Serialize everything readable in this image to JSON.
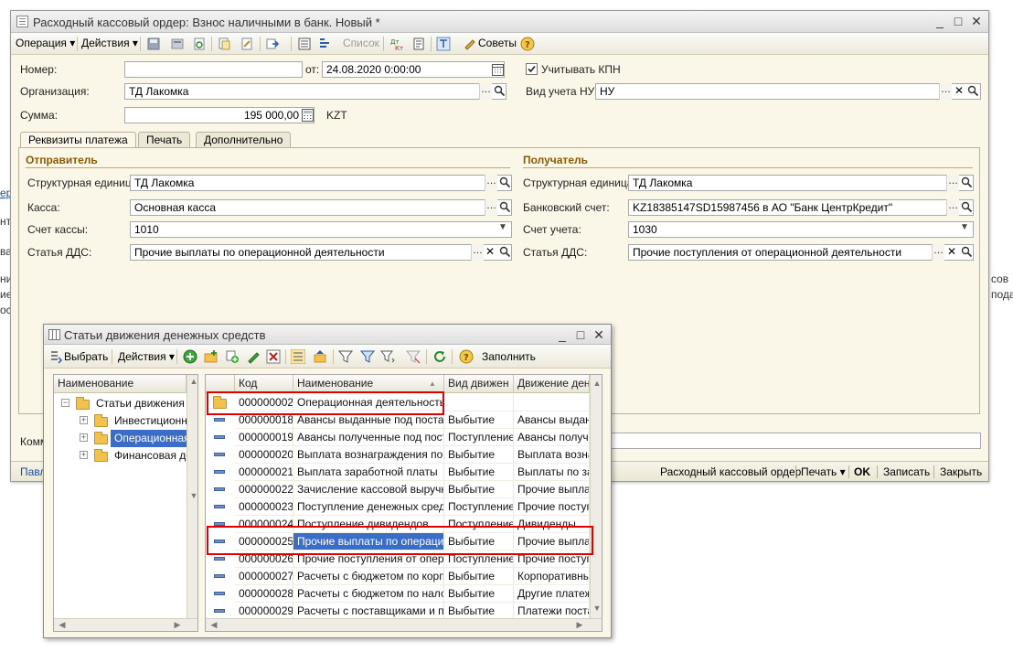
{
  "background": {
    "left_fragments": [
      "ер",
      "нт",
      "ва",
      "ни",
      "ие",
      "ос"
    ],
    "right_fragments": [
      "сов",
      "пода"
    ]
  },
  "main_window": {
    "title": "Расходный кассовый ордер: Взнос наличными в банк. Новый *",
    "controls": [
      "_",
      "□",
      "✕"
    ],
    "toolbar": {
      "operation": "Операция ▾",
      "actions": "Действия ▾",
      "list": "Список",
      "advice": "Советы"
    },
    "fields": {
      "number_label": "Номер:",
      "number_value": "",
      "date_label": "от:",
      "date_value": "24.08.2020  0:00:00",
      "kpn_label": "Учитывать КПН",
      "org_label": "Организация:",
      "org_value": "ТД Лакомка",
      "nu_label": "Вид учета НУ:",
      "nu_value": "НУ",
      "sum_label": "Сумма:",
      "sum_value": "195 000,00",
      "currency": "KZT"
    },
    "tabs": [
      "Реквизиты платежа",
      "Печать",
      "Дополнительно"
    ],
    "sender": {
      "title": "Отправитель",
      "unit_label": "Структурная единица:",
      "unit_value": "ТД Лакомка",
      "cash_label": "Касса:",
      "cash_value": "Основная касса",
      "account_label": "Счет кассы:",
      "account_value": "1010",
      "dds_label": "Статья ДДС:",
      "dds_value": "Прочие выплаты по операционной деятельности"
    },
    "receiver": {
      "title": "Получатель",
      "unit_label": "Структурная единица:",
      "unit_value": "ТД Лакомка",
      "bank_label": "Банковский счет:",
      "bank_value": "KZ18385147SD15987456 в АО \"Банк ЦентрКредит\"",
      "account_label": "Счет учета:",
      "account_value": "1030",
      "dds_label": "Статья ДДС:",
      "dds_value": "Прочие поступления от операционной деятельности"
    },
    "comment_label": "Комм",
    "status_left": "Павл",
    "statusbar": {
      "doc": "Расходный кассовый ордер",
      "print": "Печать ▾",
      "ok": "OK",
      "save": "Записать",
      "close": "Закрыть"
    }
  },
  "dialog": {
    "title": "Статьи движения денежных средств",
    "toolbar": {
      "select": "Выбрать",
      "actions": "Действия ▾",
      "fill": "Заполнить"
    },
    "tree": {
      "header": "Наименование",
      "root": "Статьи движения д",
      "items": [
        "Инвестиционна",
        "Операционная д",
        "Финансовая де"
      ],
      "selected_index": 1
    },
    "table": {
      "headers": [
        "Код",
        "Наименование",
        "Вид движен",
        "Движение дене"
      ],
      "rows": [
        {
          "code": "000000002",
          "name": "Операционная деятельность",
          "kind": "",
          "move": "",
          "folder": true
        },
        {
          "code": "000000018",
          "name": "Авансы выданные под поста...",
          "kind": "Выбытие",
          "move": "Авансы выданн"
        },
        {
          "code": "000000019",
          "name": "Авансы полученные под пост...",
          "kind": "Поступление",
          "move": "Авансы получе"
        },
        {
          "code": "000000020",
          "name": "Выплата вознаграждения по ...",
          "kind": "Выбытие",
          "move": "Выплата возна"
        },
        {
          "code": "000000021",
          "name": "Выплата заработной платы",
          "kind": "Выбытие",
          "move": "Выплаты по за"
        },
        {
          "code": "000000022",
          "name": "Зачисление кассовой выручк...",
          "kind": "Выбытие",
          "move": "Прочие выплат"
        },
        {
          "code": "000000023",
          "name": "Поступление денежных сред...",
          "kind": "Поступление",
          "move": "Прочие поступ"
        },
        {
          "code": "000000024",
          "name": "Поступление дивидендов",
          "kind": "Поступление",
          "move": "Дивиденды"
        },
        {
          "code": "000000025",
          "name": "Прочие выплаты по операци...",
          "kind": "Выбытие",
          "move": "Прочие выплат"
        },
        {
          "code": "000000026",
          "name": "Прочие поступления от опер...",
          "kind": "Поступление",
          "move": "Прочие поступ"
        },
        {
          "code": "000000027",
          "name": "Расчеты с бюджетом по корп...",
          "kind": "Выбытие",
          "move": "Корпоративный"
        },
        {
          "code": "000000028",
          "name": "Расчеты с бюджетом по нало...",
          "kind": "Выбытие",
          "move": "Другие платеж"
        },
        {
          "code": "000000029",
          "name": "Расчеты с поставщиками и п...",
          "kind": "Выбытие",
          "move": "Платежи поста"
        }
      ],
      "selected_index": 8
    }
  },
  "colors": {
    "highlight": "#e00000",
    "selection": "#3b6cc6",
    "window_bg": "#fbf7e8"
  }
}
